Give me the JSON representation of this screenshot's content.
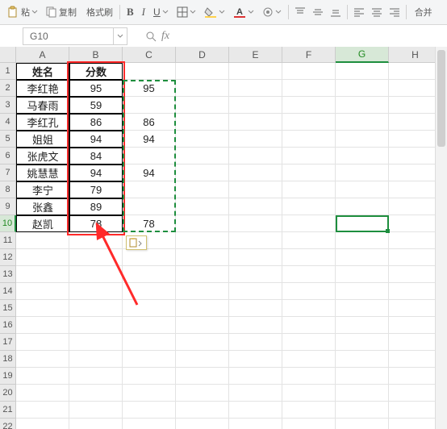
{
  "ribbon": {
    "paste_label": "粘",
    "copy_label": "复制",
    "format_painter_label": "格式刷",
    "merge_label": "合并"
  },
  "namebox": {
    "value": "G10"
  },
  "formula_bar": {
    "value": ""
  },
  "columns": [
    "A",
    "B",
    "C",
    "D",
    "E",
    "F",
    "G",
    "H"
  ],
  "active_cell": "G10",
  "table": {
    "headers": {
      "name": "姓名",
      "score": "分数"
    },
    "rows": [
      {
        "name": "李红艳",
        "score": 95,
        "c": 95
      },
      {
        "name": "马春雨",
        "score": 59,
        "c": ""
      },
      {
        "name": "李红孔",
        "score": 86,
        "c": 86
      },
      {
        "name": "姐姐",
        "score": 94,
        "c": 94
      },
      {
        "name": "张虎文",
        "score": 84,
        "c": ""
      },
      {
        "name": "姚慧慧",
        "score": 94,
        "c": 94
      },
      {
        "name": "李宁",
        "score": 79,
        "c": ""
      },
      {
        "name": "张鑫",
        "score": 89,
        "c": ""
      },
      {
        "name": "赵凯",
        "score": 78,
        "c": 78
      }
    ]
  },
  "row_count_visible": 22
}
